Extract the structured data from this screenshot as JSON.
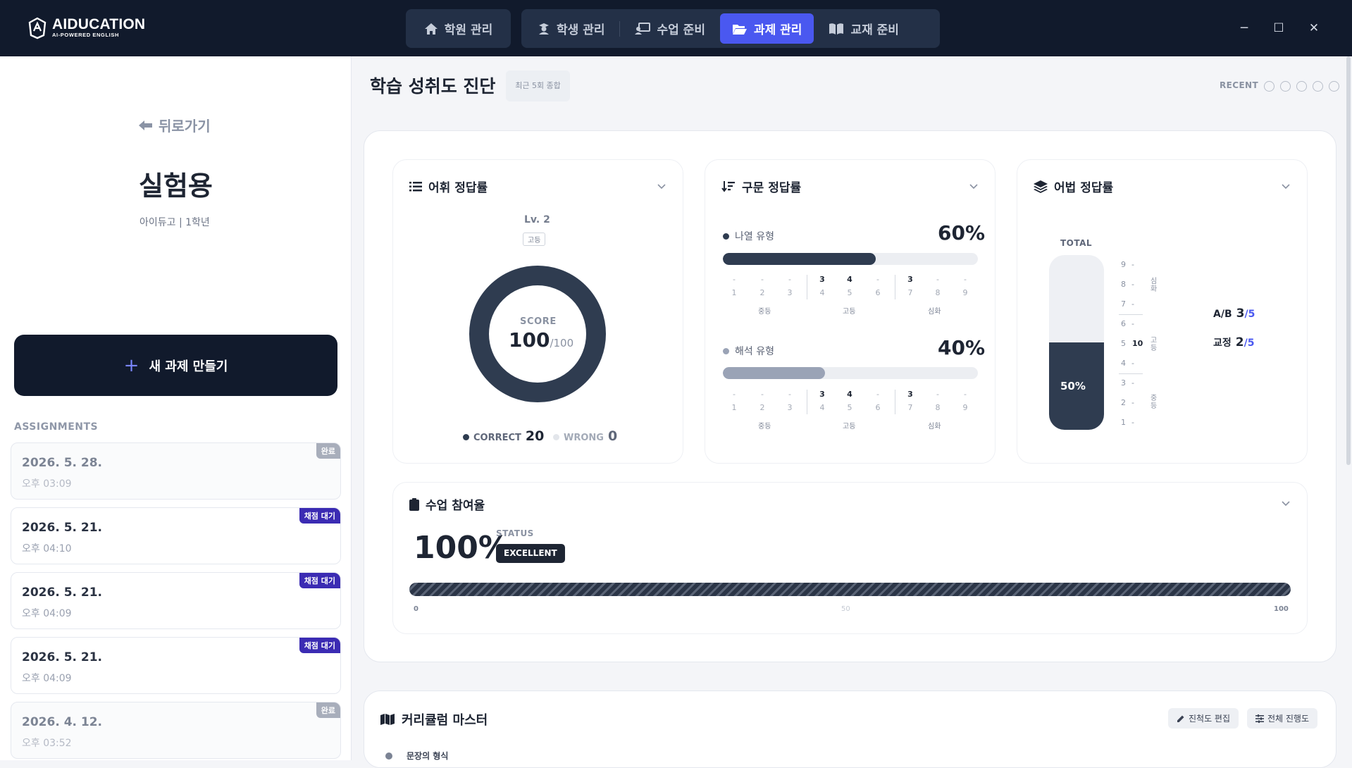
{
  "app": {
    "logo_title": "AIDUCATION",
    "logo_sub": "AI-POWERED ENGLISH"
  },
  "nav": {
    "items": [
      {
        "label": "학원 관리",
        "icon": "home-icon"
      },
      {
        "label": "학생 관리",
        "icon": "student-icon"
      },
      {
        "label": "수업 준비",
        "icon": "teacher-icon"
      },
      {
        "label": "과제 관리",
        "icon": "folder-open-icon",
        "active": true
      },
      {
        "label": "교재 준비",
        "icon": "book-icon"
      }
    ]
  },
  "window": {
    "minimize": "─",
    "maximize": "☐",
    "close": "✕"
  },
  "sidebar": {
    "back_label": "뒤로가기",
    "student_name": "실험용",
    "student_info": "아이듀고 | 1학년",
    "new_button": "새 과제 만들기",
    "assignments_header": "ASSIGNMENTS",
    "assignments": [
      {
        "date": "2026. 5. 28.",
        "time": "오후 03:09",
        "status": "완료",
        "kind": "done"
      },
      {
        "date": "2026. 5. 21.",
        "time": "오후 04:10",
        "status": "채점 대기",
        "kind": "wait"
      },
      {
        "date": "2026. 5. 21.",
        "time": "오후 04:09",
        "status": "채점 대기",
        "kind": "wait"
      },
      {
        "date": "2026. 5. 21.",
        "time": "오후 04:09",
        "status": "채점 대기",
        "kind": "wait"
      },
      {
        "date": "2026. 4. 12.",
        "time": "오후 03:52",
        "status": "완료",
        "kind": "done"
      }
    ]
  },
  "main": {
    "title": "학습 성취도 진단",
    "chip": "최근 5회 종합",
    "recent_label": "RECENT"
  },
  "vocab": {
    "title": "어휘 정답률",
    "level": "Lv. 2",
    "level_tag": "고등",
    "score_label": "SCORE",
    "score": "100",
    "score_max": "/100",
    "correct_label": "CORRECT",
    "correct": "20",
    "wrong_label": "WRONG",
    "wrong": "0",
    "score_fraction": 1.0
  },
  "syntax": {
    "title": "구문 정답률",
    "rows": [
      {
        "label": "나열 유형",
        "pct": "60%",
        "fraction": 0.6,
        "color": "#2f3c50"
      },
      {
        "label": "해석 유형",
        "pct": "40%",
        "fraction": 0.4,
        "color": "#9aa3b6"
      }
    ],
    "dash": "-",
    "ticks": [
      "1",
      "2",
      "3",
      "4",
      "5",
      "6",
      "7",
      "8",
      "9"
    ],
    "top_vals": [
      "3",
      "4",
      "3"
    ],
    "groups": [
      "중등",
      "고등",
      "심화"
    ]
  },
  "grammar": {
    "title": "어법 정답률",
    "total_label": "TOTAL",
    "total_pct": "50%",
    "fraction": 0.5,
    "scale": [
      "9",
      "8",
      "7",
      "6",
      "5",
      "4",
      "3",
      "2",
      "1"
    ],
    "scale_dash": "-",
    "scale_value": "10",
    "bands": [
      "심화",
      "고등",
      "중등"
    ],
    "ab_label": "A/B",
    "ab_value": "3",
    "ab_max": "/5",
    "fix_label": "교정",
    "fix_value": "2",
    "fix_max": "/5"
  },
  "participation": {
    "title": "수업 참여율",
    "value": "100%",
    "status_label": "STATUS",
    "status": "EXCELLENT",
    "axis": [
      "0",
      "50",
      "100"
    ]
  },
  "curriculum": {
    "title": "커리큘럼 마스터",
    "edit_button": "진척도 편집",
    "progress_button": "전체 진행도",
    "first_item": "문장의 형식"
  }
}
